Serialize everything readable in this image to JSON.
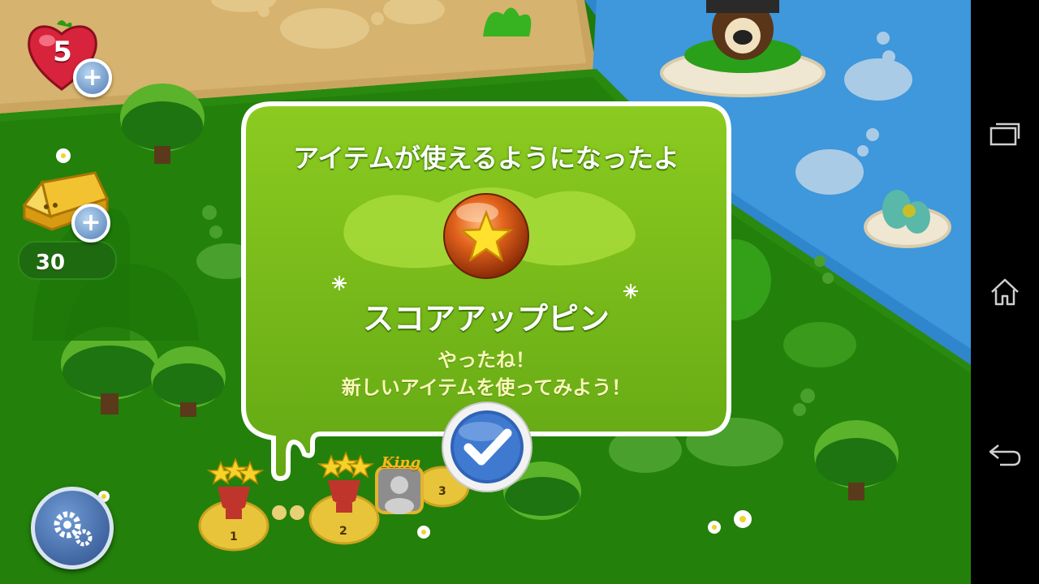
{
  "hud": {
    "lives": "5",
    "gold_bars": "30",
    "plus_label": "+"
  },
  "popup": {
    "title": "アイテムが使えるようになったよ",
    "item_name": "スコアアップピン",
    "message_line1": "やったね！",
    "message_line2": "新しいアイテムを使ってみよう！"
  },
  "map": {
    "level_trophies": [
      "1",
      "2",
      "3"
    ],
    "king_badge": "King"
  },
  "icons": {
    "lives": "heart-icon",
    "gold": "gold-bar-icon",
    "star": "star-icon",
    "confirm": "checkmark-icon",
    "settings": "gear-icon",
    "nav_recents": "recent-apps-icon",
    "nav_home": "home-icon",
    "nav_back": "back-icon"
  },
  "colors": {
    "popup_green": "#7cbc1a",
    "popup_border": "#ffffff",
    "message_text": "#fbf7b9",
    "sand": "#d6b36e",
    "water": "#2f86cc",
    "grass": "#2a8a10"
  }
}
